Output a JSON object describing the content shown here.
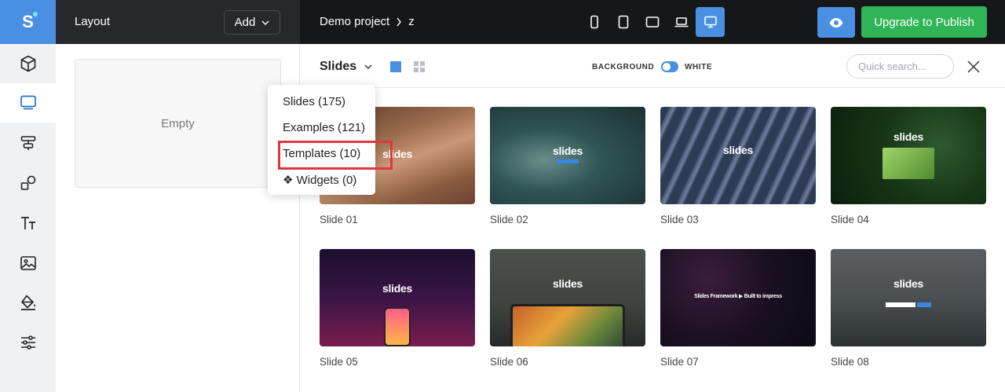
{
  "topbar": {
    "logo_letter": "S",
    "layout_title": "Layout",
    "add_label": "Add",
    "project_name": "Demo project",
    "page_name": "z",
    "publish_label": "Upgrade to Publish",
    "devices": [
      "phone-small-icon",
      "tablet-portrait-icon",
      "tablet-landscape-icon",
      "laptop-icon",
      "desktop-icon"
    ],
    "active_device": "desktop-icon"
  },
  "sidebar": {
    "items": [
      "cube-icon",
      "monitor-icon",
      "layout-blocks-icon",
      "shapes-icon",
      "text-icon",
      "image-icon",
      "paint-bucket-icon",
      "sliders-icon"
    ],
    "active": "monitor-icon"
  },
  "layout_panel": {
    "empty_label": "Empty"
  },
  "library": {
    "category": "Slides",
    "background_label": "BACKGROUND",
    "background_value": "WHITE",
    "search_placeholder": "Quick search...",
    "cards": [
      {
        "label": "Slide 01",
        "brand": "slides"
      },
      {
        "label": "Slide 02",
        "brand": "slides"
      },
      {
        "label": "Slide 03",
        "brand": "slides"
      },
      {
        "label": "Slide 04",
        "brand": "slides"
      },
      {
        "label": "Slide 05",
        "brand": "slides"
      },
      {
        "label": "Slide 06",
        "brand": "slides"
      },
      {
        "label": "Slide 07",
        "brand": "Slides Framework  ▶  Built to impress"
      },
      {
        "label": "Slide 08",
        "brand": "slides"
      }
    ]
  },
  "dropdown": {
    "items": [
      "Slides (175)",
      "Examples (121)",
      "Templates (10)",
      "❖ Widgets (0)"
    ],
    "highlighted": "Templates (10)"
  },
  "colors": {
    "accent": "#4a90e2",
    "publish": "#2fb456",
    "highlight": "#e0373f",
    "topbar": "#161719"
  }
}
